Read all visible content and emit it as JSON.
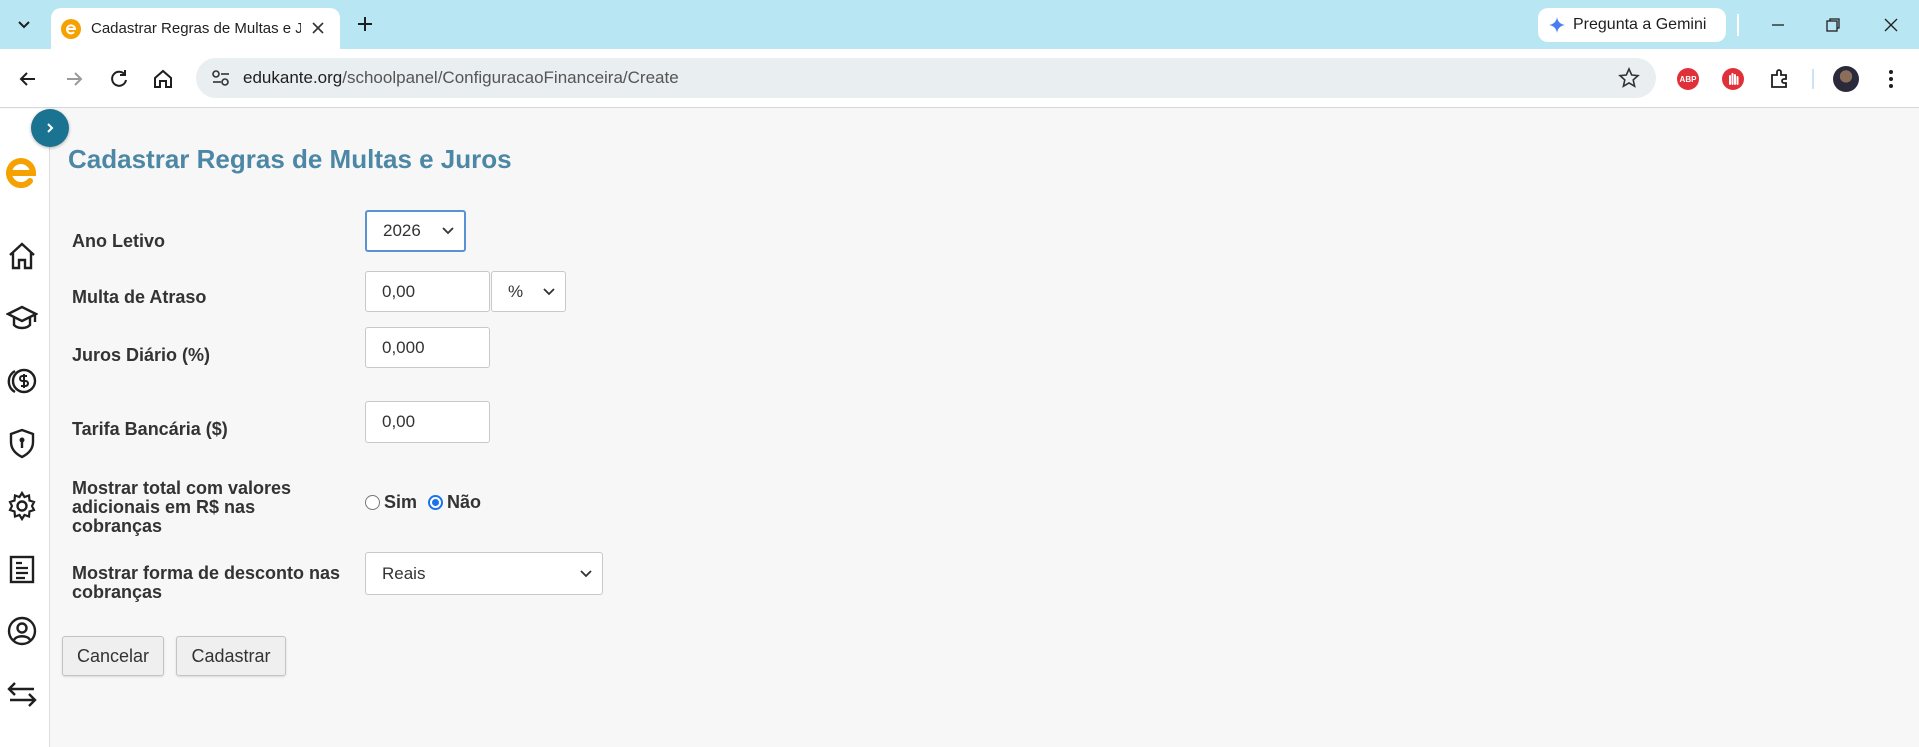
{
  "browser": {
    "tab_title": "Cadastrar Regras de Multas e Juros",
    "gemini_label": "Pregunta a Gemini",
    "url_host": "edukante.org",
    "url_path": "/schoolpanel/ConfiguracaoFinanceira/Create",
    "abp_label": "ABP"
  },
  "page": {
    "title": "Cadastrar Regras de Multas e Juros",
    "ano_letivo": {
      "label": "Ano Letivo",
      "value": "2026"
    },
    "multa": {
      "label": "Multa de Atraso",
      "value": "0,00",
      "unit": "%"
    },
    "juros": {
      "label": "Juros Diário (%)",
      "value": "0,000"
    },
    "tarifa": {
      "label": "Tarifa Bancária ($)",
      "value": "0,00"
    },
    "mostrar_total": {
      "label": "Mostrar total com valores adicionais em R$ nas cobranças",
      "option_yes": "Sim",
      "option_no": "Não",
      "selected": "Não"
    },
    "mostrar_desconto": {
      "label": "Mostrar forma de desconto nas cobranças",
      "value": "Reais"
    },
    "cancel_label": "Cancelar",
    "submit_label": "Cadastrar"
  },
  "sidebar_icons": [
    "home-icon",
    "graduation-cap-icon",
    "finance-coin-icon",
    "shield-icon",
    "gear-icon",
    "document-icon",
    "user-icon",
    "transfer-arrows-icon"
  ],
  "colors": {
    "accent": "#4d87a6",
    "toggle": "#1a7391",
    "logo": "#f5a100",
    "tabstrip": "#b8e6f2"
  }
}
